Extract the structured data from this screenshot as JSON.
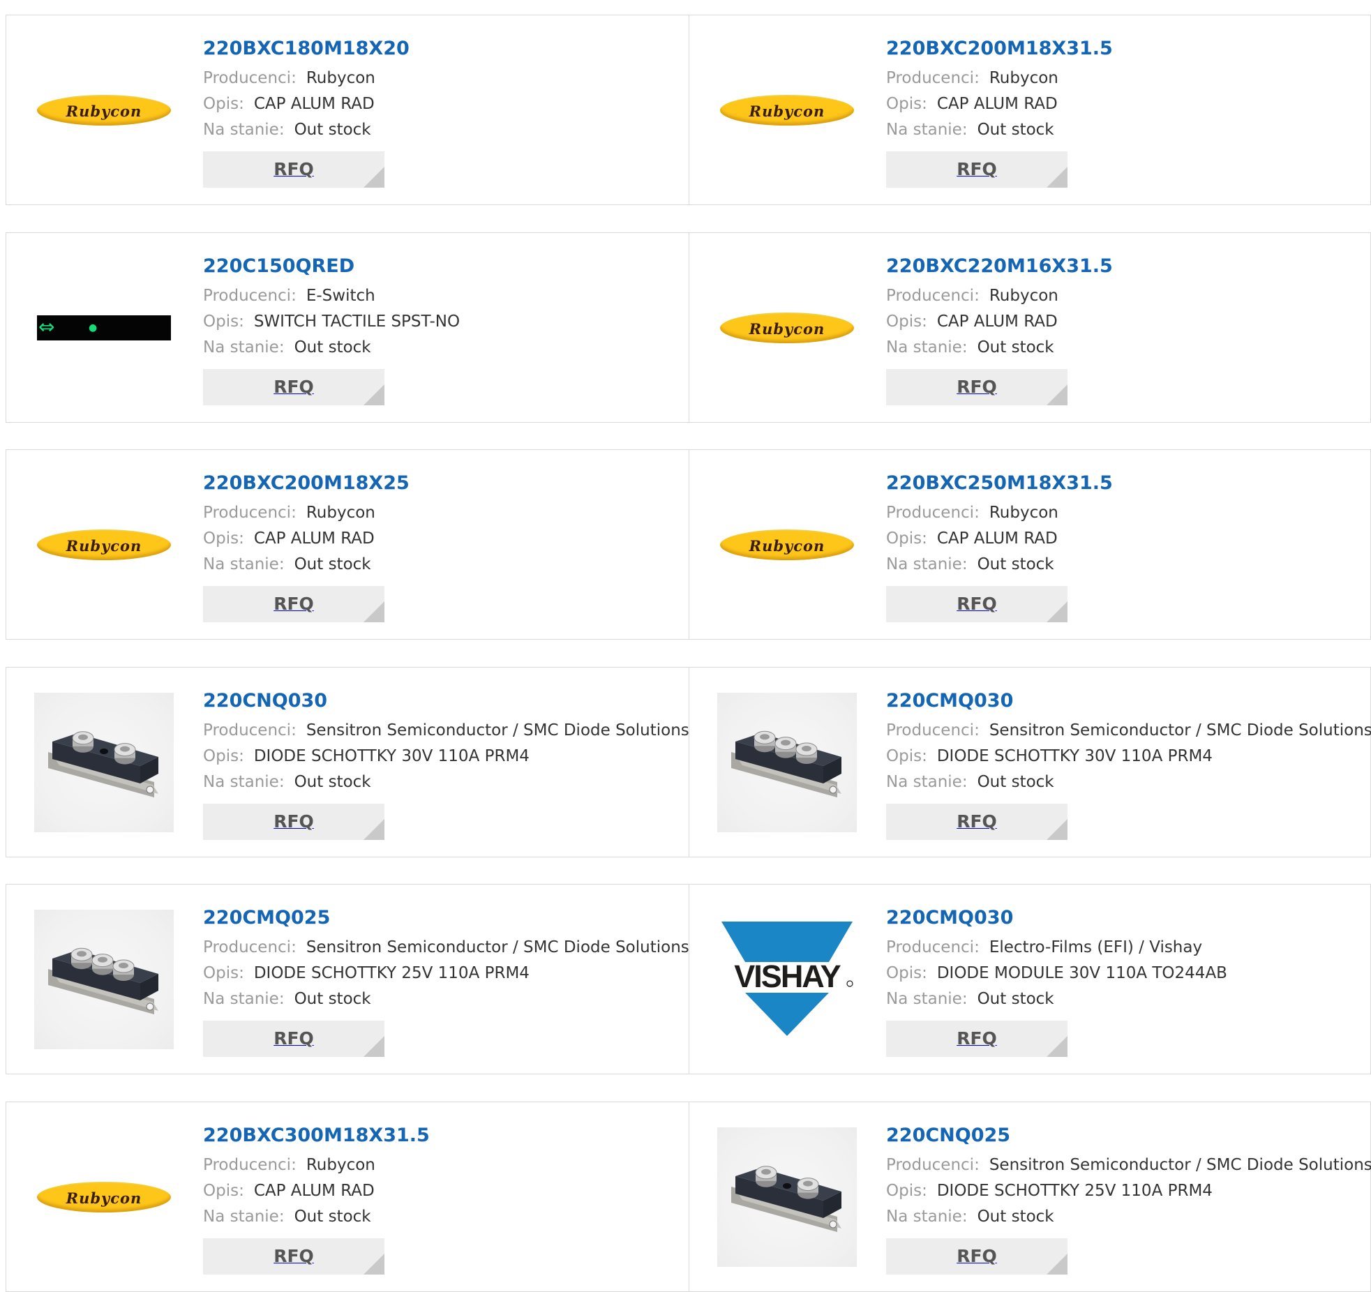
{
  "labels": {
    "manufacturer": "Producenci:",
    "description": "Opis:",
    "stock": "Na stanie:",
    "rfq": "RFQ"
  },
  "colors": {
    "link": "#1565b5",
    "label_gray": "#9a9a9a",
    "value": "#333333",
    "button_bg": "#ededed",
    "rubycon_yellow": "#ffc61a",
    "vishay_blue": "#1a86c6"
  },
  "rows": [
    [
      {
        "part": "220BXC180M18X20",
        "manufacturer": "Rubycon",
        "description": "CAP ALUM RAD",
        "stock": "Out stock",
        "image": "rubycon-logo",
        "logo_text": "Rubycon"
      },
      {
        "part": "220BXC200M18X31.5",
        "manufacturer": "Rubycon",
        "description": "CAP ALUM RAD",
        "stock": "Out stock",
        "image": "rubycon-logo",
        "logo_text": "Rubycon"
      }
    ],
    [
      {
        "part": "220C150QRED",
        "manufacturer": "E-Switch",
        "description": "SWITCH TACTILE SPST-NO",
        "stock": "Out stock",
        "image": "e-switch-display"
      },
      {
        "part": "220BXC220M16X31.5",
        "manufacturer": "Rubycon",
        "description": "CAP ALUM RAD",
        "stock": "Out stock",
        "image": "rubycon-logo",
        "logo_text": "Rubycon"
      }
    ],
    [
      {
        "part": "220BXC200M18X25",
        "manufacturer": "Rubycon",
        "description": "CAP ALUM RAD",
        "stock": "Out stock",
        "image": "rubycon-logo",
        "logo_text": "Rubycon"
      },
      {
        "part": "220BXC250M18X31.5",
        "manufacturer": "Rubycon",
        "description": "CAP ALUM RAD",
        "stock": "Out stock",
        "image": "rubycon-logo",
        "logo_text": "Rubycon"
      }
    ],
    [
      {
        "part": "220CNQ030",
        "manufacturer": "Sensitron Semiconductor / SMC Diode Solutions",
        "description": "DIODE SCHOTTKY 30V 110A PRM4",
        "stock": "Out stock",
        "image": "diode-module-2-screws"
      },
      {
        "part": "220CMQ030",
        "manufacturer": "Sensitron Semiconductor / SMC Diode Solutions",
        "description": "DIODE SCHOTTKY 30V 110A PRM4",
        "stock": "Out stock",
        "image": "diode-module-3-screws"
      }
    ],
    [
      {
        "part": "220CMQ025",
        "manufacturer": "Sensitron Semiconductor / SMC Diode Solutions",
        "description": "DIODE SCHOTTKY 25V 110A PRM4",
        "stock": "Out stock",
        "image": "diode-module-3-screws"
      },
      {
        "part": "220CMQ030",
        "manufacturer": "Electro-Films (EFI) / Vishay",
        "description": "DIODE MODULE 30V 110A TO244AB",
        "stock": "Out stock",
        "image": "vishay-logo",
        "logo_text": "VISHAY"
      }
    ],
    [
      {
        "part": "220BXC300M18X31.5",
        "manufacturer": "Rubycon",
        "description": "CAP ALUM RAD",
        "stock": "Out stock",
        "image": "rubycon-logo",
        "logo_text": "Rubycon"
      },
      {
        "part": "220CNQ025",
        "manufacturer": "Sensitron Semiconductor / SMC Diode Solutions",
        "description": "DIODE SCHOTTKY 25V 110A PRM4",
        "stock": "Out stock",
        "image": "diode-module-2-screws"
      }
    ]
  ]
}
